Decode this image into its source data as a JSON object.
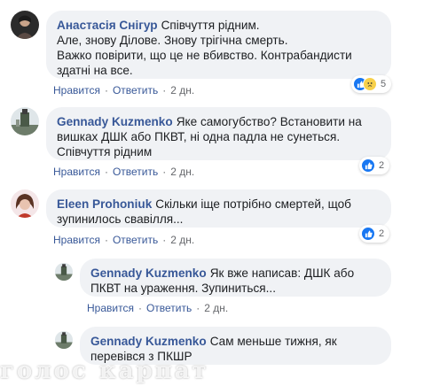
{
  "actions": {
    "like": "Нравится",
    "reply": "Ответить",
    "separator": "·"
  },
  "comments": [
    {
      "author": "Анастасія Снігур",
      "text": "Співчуття рідним.\nАле, знову Ділове. Знову трігічна смерть.\nВажко повірити, що це не вбивство. Контрабандисти здатні на все.",
      "time": "2 дн.",
      "reactions": {
        "icons": [
          "like-icon",
          "sad-icon"
        ],
        "count": "5"
      }
    },
    {
      "author": "Gennady Kuzmenko",
      "text": "Яке самогубство? Встановити на вишках ДШК або ПКВТ, ні одна падла не сунеться. Співчуття рідним",
      "time": "2 дн.",
      "reactions": {
        "icons": [
          "like-icon"
        ],
        "count": "2"
      }
    },
    {
      "author": "Eleen Prohoniuk",
      "text": "Скільки іще потрібно смертей, щоб зупинилось свавілля...",
      "time": "2 дн.",
      "reactions": {
        "icons": [
          "like-icon"
        ],
        "count": "2"
      }
    }
  ],
  "replies": [
    {
      "author": "Gennady Kuzmenko",
      "text": "Як вже написав: ДШК або ПКВТ на ураження. Зупиниться...",
      "time": "2 дн."
    },
    {
      "author": "Gennady Kuzmenko",
      "text": "Сам меньше тижня, як перевівся з ПКШР"
    }
  ],
  "watermark": "голос карпат",
  "colors": {
    "author": "#385898",
    "bubble": "#f0f2f5",
    "meta": "#65676b",
    "like": "#1877f2"
  }
}
